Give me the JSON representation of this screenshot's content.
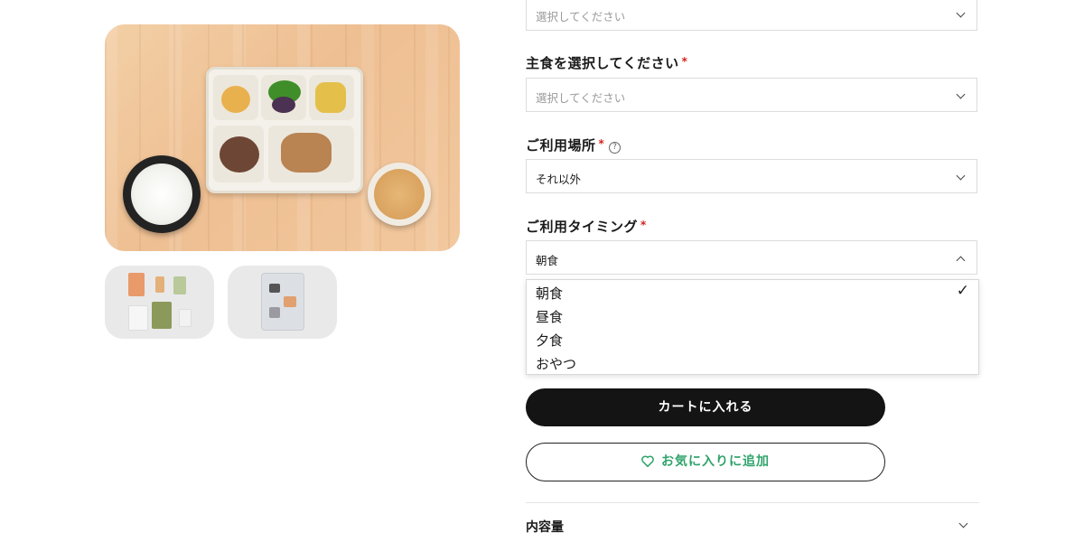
{
  "form": {
    "select_first": {
      "value": "選択してください"
    },
    "staple": {
      "label": "主食を選択してください",
      "required_mark": "*",
      "value": "選択してください"
    },
    "location": {
      "label": "ご利用場所",
      "required_mark": "*",
      "help_icon": "?",
      "value": "それ以外"
    },
    "timing": {
      "label": "ご利用タイミング",
      "required_mark": "*",
      "value": "朝食",
      "options": [
        "朝食",
        "昼食",
        "夕食",
        "おやつ"
      ],
      "selected_mark": "✓"
    }
  },
  "actions": {
    "add_to_cart": "カートに入れる",
    "add_favorite": "お気に入りに追加"
  },
  "accordion": {
    "contents_label": "内容量"
  },
  "colors": {
    "accent_green": "#2fa36a",
    "primary_button": "#141414",
    "required_red": "#d6201c"
  },
  "icons": [
    "chevron-down-icon",
    "chevron-up-icon",
    "help-circle-icon",
    "check-icon",
    "heart-icon"
  ]
}
